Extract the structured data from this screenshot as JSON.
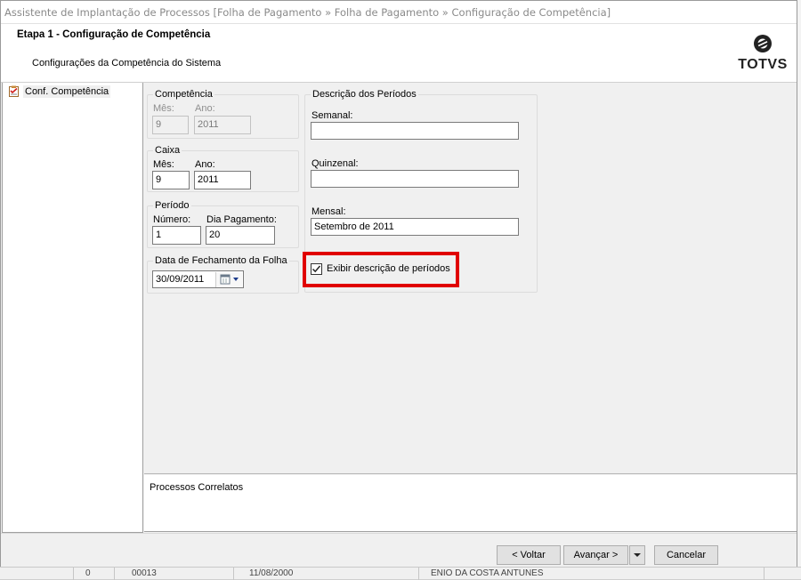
{
  "window": {
    "title": "Assistente de Implantação de Processos [Folha de Pagamento » Folha de Pagamento » Configuração de Competência]"
  },
  "header": {
    "step_title": "Etapa 1 - Configuração de Competência",
    "step_subtitle": "Configurações da Competência do Sistema",
    "logo_text": "TOTVS"
  },
  "sidebar": {
    "items": [
      {
        "label": "Conf. Competência",
        "icon": "checklist-icon"
      }
    ]
  },
  "competencia": {
    "legend": "Competência",
    "mes_label": "Mês:",
    "mes_value": "9",
    "ano_label": "Ano:",
    "ano_value": "2011"
  },
  "caixa": {
    "legend": "Caixa",
    "mes_label": "Mês:",
    "mes_value": "9",
    "ano_label": "Ano:",
    "ano_value": "2011"
  },
  "periodo": {
    "legend": "Período",
    "numero_label": "Número:",
    "numero_value": "1",
    "dia_label": "Dia Pagamento:",
    "dia_value": "20"
  },
  "fechamento": {
    "legend": "Data de Fechamento da Folha",
    "date_value": "30/09/2011"
  },
  "descricao": {
    "legend": "Descrição dos Períodos",
    "semanal_label": "Semanal:",
    "semanal_value": "",
    "quinzenal_label": "Quinzenal:",
    "quinzenal_value": "",
    "mensal_label": "Mensal:",
    "mensal_value": "Setembro de 2011",
    "checkbox_label": "Exibir descrição de períodos",
    "checkbox_checked": true
  },
  "correlatos": {
    "label": "Processos Correlatos"
  },
  "footer": {
    "back_label": "< Voltar",
    "next_label": "Avançar >",
    "cancel_label": "Cancelar"
  },
  "background": {
    "row_texts": [
      "0",
      "00013",
      "11/08/2000",
      "ENIO DA COSTA ANTUNES"
    ]
  },
  "colors": {
    "highlight": "#e00000"
  }
}
